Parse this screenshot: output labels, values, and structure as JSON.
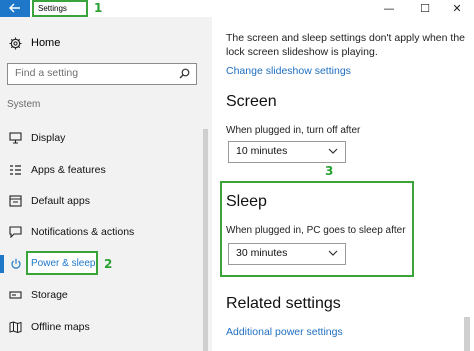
{
  "titlebar": {
    "back_icon": "back-arrow-icon",
    "title": "Settings",
    "annotation_1": "1",
    "minimize": "—",
    "maximize": "☐",
    "close": "✕"
  },
  "sidebar": {
    "home_label": "Home",
    "search_placeholder": "Find a setting",
    "section_label": "System",
    "items": [
      {
        "label": "Display",
        "icon": "display-icon"
      },
      {
        "label": "Apps & features",
        "icon": "apps-icon"
      },
      {
        "label": "Default apps",
        "icon": "default-apps-icon"
      },
      {
        "label": "Notifications & actions",
        "icon": "notifications-icon"
      },
      {
        "label": "Power & sleep",
        "icon": "power-icon",
        "active": true
      },
      {
        "label": "Storage",
        "icon": "storage-icon"
      },
      {
        "label": "Offline maps",
        "icon": "map-icon"
      }
    ],
    "annotation_2": "2"
  },
  "main": {
    "note": "The screen and sleep settings don't apply when the lock screen slideshow is playing.",
    "slideshow_link": "Change slideshow settings",
    "screen_heading": "Screen",
    "screen_label": "When plugged in, turn off after",
    "screen_value": "10 minutes",
    "annotation_3": "3",
    "sleep_heading": "Sleep",
    "sleep_label": "When plugged in, PC goes to sleep after",
    "sleep_value": "30 minutes",
    "related_heading": "Related settings",
    "power_link": "Additional power settings"
  },
  "colors": {
    "accent": "#1f77c9",
    "annotation_green": "#3aa33a",
    "sidebar_bg": "#f2f2f2"
  }
}
